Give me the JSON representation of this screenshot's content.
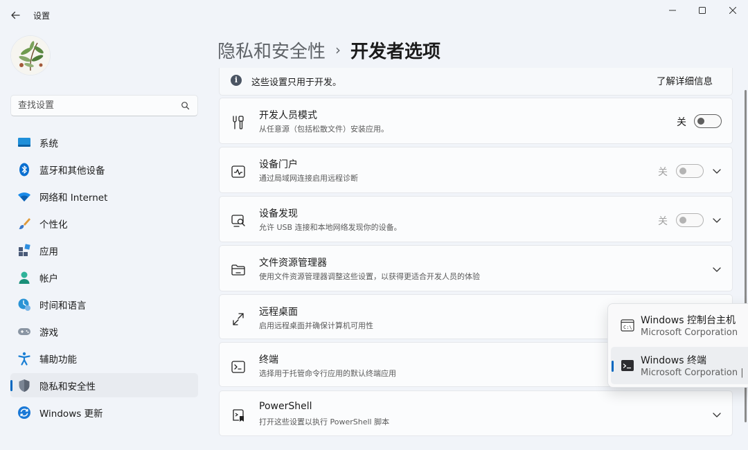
{
  "app": {
    "title": "设置"
  },
  "search": {
    "placeholder": "查找设置"
  },
  "sidebar": {
    "items": [
      {
        "label": "系统",
        "icon": "system-icon"
      },
      {
        "label": "蓝牙和其他设备",
        "icon": "bluetooth-icon"
      },
      {
        "label": "网络和 Internet",
        "icon": "wifi-icon"
      },
      {
        "label": "个性化",
        "icon": "brush-icon"
      },
      {
        "label": "应用",
        "icon": "apps-icon"
      },
      {
        "label": "帐户",
        "icon": "account-icon"
      },
      {
        "label": "时间和语言",
        "icon": "time-language-icon"
      },
      {
        "label": "游戏",
        "icon": "gamepad-icon"
      },
      {
        "label": "辅助功能",
        "icon": "accessibility-icon"
      },
      {
        "label": "隐私和安全性",
        "icon": "shield-icon",
        "active": true
      },
      {
        "label": "Windows 更新",
        "icon": "windows-update-icon"
      }
    ]
  },
  "header": {
    "parent": "隐私和安全性",
    "separator": "›",
    "current": "开发者选项"
  },
  "info": {
    "text": "这些设置只用于开发。",
    "link": "了解详细信息",
    "icon": "info-icon"
  },
  "cards": [
    {
      "title": "开发人员模式",
      "desc": "从任意源（包括松散文件）安装应用。",
      "toggle_label": "关",
      "toggle_on": false,
      "icon": "developer-tools-icon"
    },
    {
      "title": "设备门户",
      "desc": "通过局域网连接启用远程诊断",
      "toggle_label": "关",
      "toggle_on": false,
      "disabled": true,
      "icon": "device-portal-icon"
    },
    {
      "title": "设备发现",
      "desc": "允许 USB 连接和本地网络发现你的设备。",
      "toggle_label": "关",
      "toggle_on": false,
      "disabled": true,
      "icon": "device-discovery-icon"
    },
    {
      "title": "文件资源管理器",
      "desc": "使用文件资源管理器调整这些设置，以获得更适合开发人员的体验",
      "icon": "folder-icon"
    },
    {
      "title": "远程桌面",
      "desc": "启用远程桌面并确保计算机可用性",
      "icon": "remote-desktop-icon"
    },
    {
      "title": "终端",
      "desc": "选择用于托管命令行应用的默认终端应用",
      "icon": "terminal-icon"
    },
    {
      "title": "PowerShell",
      "desc": "打开这些设置以执行 PowerShell 脚本",
      "icon": "powershell-icon"
    }
  ],
  "terminal_flyout": {
    "options": [
      {
        "title": "Windows 控制台主机",
        "subtitle": "Microsoft Corporation",
        "selected": false,
        "icon": "console-host-icon"
      },
      {
        "title": "Windows 终端",
        "subtitle": "Microsoft Corporation  |",
        "selected": true,
        "icon": "windows-terminal-icon"
      }
    ]
  },
  "colors": {
    "accent": "#0067c0",
    "background": "#f1f4f9",
    "card": "#fbfcfd"
  }
}
